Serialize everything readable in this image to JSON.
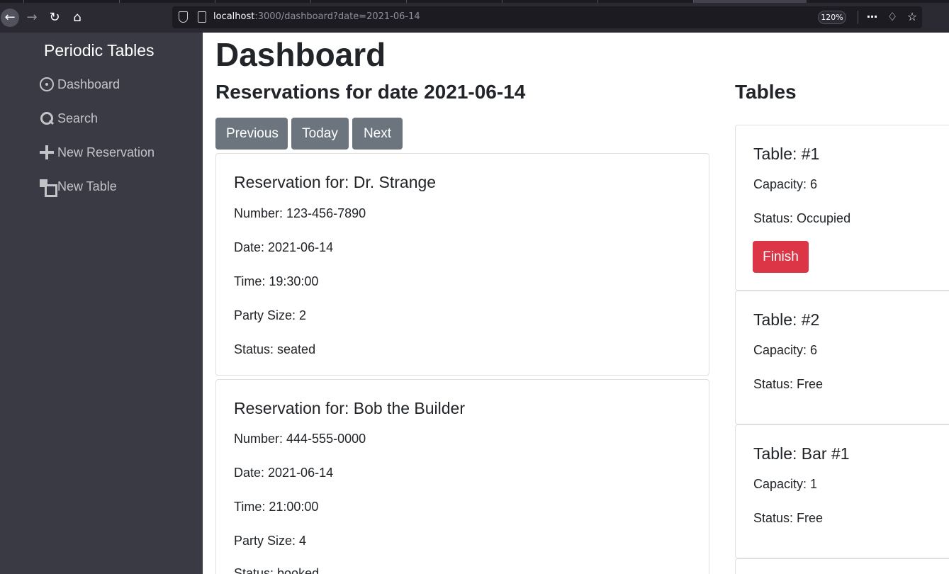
{
  "browser": {
    "url_host": "localhost",
    "url_path": ":3000/dashboard?date=2021-06-14",
    "zoom": "120%"
  },
  "sidebar": {
    "brand": "Periodic Tables",
    "items": [
      {
        "label": "Dashboard",
        "icon": "dashboard-icon"
      },
      {
        "label": "Search",
        "icon": "search-icon"
      },
      {
        "label": "New Reservation",
        "icon": "plus-icon"
      },
      {
        "label": "New Table",
        "icon": "table-icon"
      }
    ]
  },
  "main": {
    "title": "Dashboard",
    "reservations_heading": "Reservations for date 2021-06-14",
    "tables_heading": "Tables",
    "buttons": {
      "previous": "Previous",
      "today": "Today",
      "next": "Next"
    }
  },
  "reservations": [
    {
      "title": "Reservation for: Dr. Strange",
      "number": "Number: 123-456-7890",
      "date": "Date: 2021-06-14",
      "time": "Time: 19:30:00",
      "party": "Party Size: 2",
      "status": "Status: seated"
    },
    {
      "title": "Reservation for: Bob the Builder",
      "number": "Number: 444-555-0000",
      "date": "Date: 2021-06-14",
      "time": "Time: 21:00:00",
      "party": "Party Size: 4",
      "status": "Status: booked"
    }
  ],
  "tables": [
    {
      "title": "Table: #1",
      "capacity": "Capacity: 6",
      "status": "Status: Occupied",
      "finish_label": "Finish"
    },
    {
      "title": "Table: #2",
      "capacity": "Capacity: 6",
      "status": "Status: Free"
    },
    {
      "title": "Table: Bar #1",
      "capacity": "Capacity: 1",
      "status": "Status: Free"
    }
  ],
  "colors": {
    "sidebar": "#3a3a44",
    "secondary_button": "#6c757d",
    "danger_button": "#dc3545"
  }
}
